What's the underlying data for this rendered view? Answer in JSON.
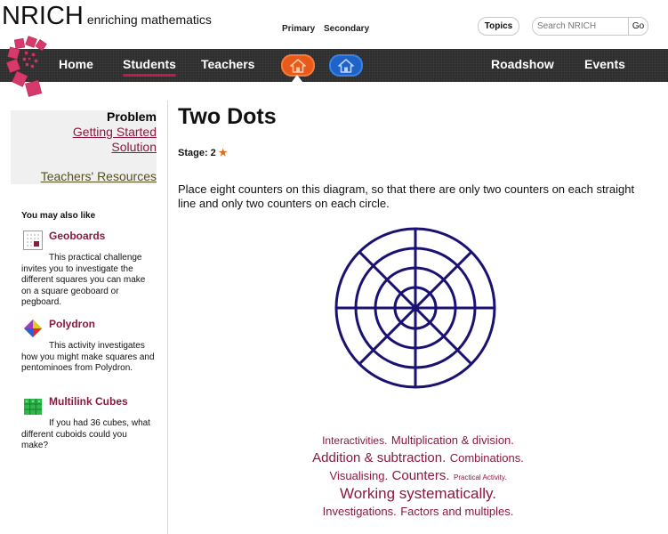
{
  "header": {
    "brand_name": "NRICH",
    "brand_tagline": "enriching mathematics",
    "topics_label": "Topics",
    "search_placeholder": "Search NRICH",
    "go_label": "Go",
    "primary_label": "Primary",
    "secondary_label": "Secondary"
  },
  "nav": {
    "home": "Home",
    "students": "Students",
    "teachers": "Teachers",
    "roadshow": "Roadshow",
    "events": "Events",
    "active": "Students"
  },
  "sidebar": {
    "heading": "Problem",
    "links": [
      "Getting Started",
      "Solution"
    ],
    "teachers_resources": "Teachers' Resources",
    "also_like_title": "You may also like",
    "recommendations": [
      {
        "title": "Geoboards",
        "desc": "This practical challenge invites you to investigate the different squares you can make on a square geoboard or pegboard."
      },
      {
        "title": "Polydron",
        "desc": "This activity investigates how you might make squares and pentominoes from Polydron."
      },
      {
        "title": "Multilink Cubes",
        "desc": "If you had 36 cubes, what different cuboids could you make?"
      }
    ]
  },
  "main": {
    "title": "Two Dots",
    "stage_label": "Stage: 2",
    "intro": "Place eight counters on this diagram, so that there are only two counters on each straight line and only two counters on each circle."
  },
  "tags": [
    [
      "Interactivities.",
      "Multiplication & division."
    ],
    [
      "Addition & subtraction.",
      "Combinations."
    ],
    [
      "Visualising.",
      "Counters.",
      "Practical Activity."
    ],
    [
      "Working systematically."
    ],
    [
      "Investigations.",
      "Factors and multiples."
    ]
  ],
  "colors": {
    "link": "#8a1a3e",
    "nav_bg": "#2a2a2a",
    "active_underline": "#c41a49",
    "primary_btn": "#e8591a",
    "secondary_btn": "#1f63c9",
    "diagram_stroke": "#1a1273"
  },
  "icons": {
    "home_primary": "home-icon",
    "home_secondary": "home-icon",
    "stage_star": "star-icon",
    "logo": "nrich-spiral-logo"
  }
}
